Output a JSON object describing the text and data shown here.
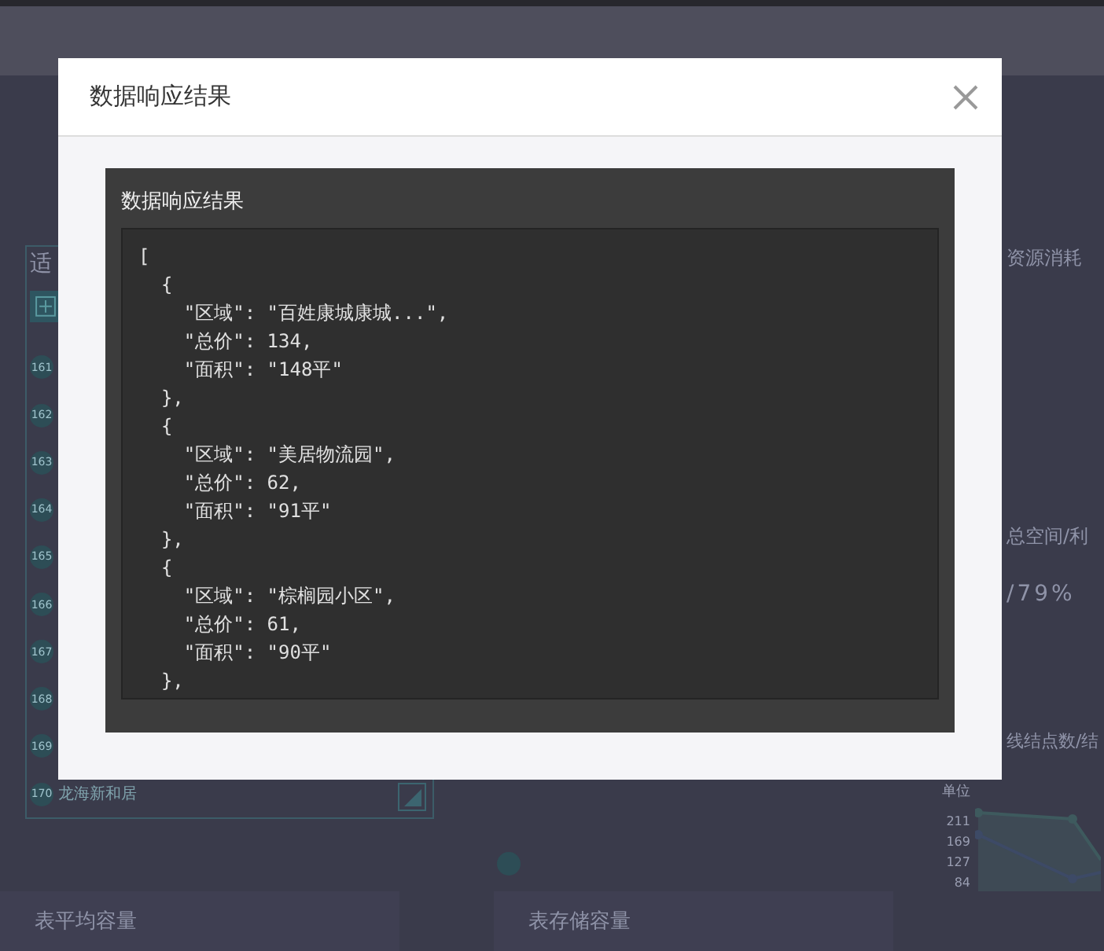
{
  "dashboard": {
    "left_panel": {
      "title": "适",
      "items": [
        {
          "number": "161"
        },
        {
          "number": "162"
        },
        {
          "number": "163"
        },
        {
          "number": "164"
        },
        {
          "number": "165"
        },
        {
          "number": "166"
        },
        {
          "number": "167"
        },
        {
          "number": "168"
        },
        {
          "number": "169"
        },
        {
          "number": "170",
          "label": "龙海新和居"
        }
      ]
    },
    "right_panel": {
      "resource_title": "资源消耗",
      "disk_title": "总空间/利",
      "disk_value": "/79%",
      "nodes_title": "线结点数/结",
      "chart_unit": "单位",
      "chart_ticks": [
        "211",
        "169",
        "127",
        "84"
      ]
    },
    "bottom_titles": [
      "表平均容量",
      "表存储容量"
    ]
  },
  "modal": {
    "title": "数据响应结果",
    "panel_title": "数据响应结果",
    "code": "[\n  {\n    \"区域\": \"百姓康城康城...\",\n    \"总价\": 134,\n    \"面积\": \"148平\"\n  },\n  {\n    \"区域\": \"美居物流园\",\n    \"总价\": 62,\n    \"面积\": \"91平\"\n  },\n  {\n    \"区域\": \"棕榈园小区\",\n    \"总价\": 61,\n    \"面积\": \"90平\"\n  },"
  }
}
